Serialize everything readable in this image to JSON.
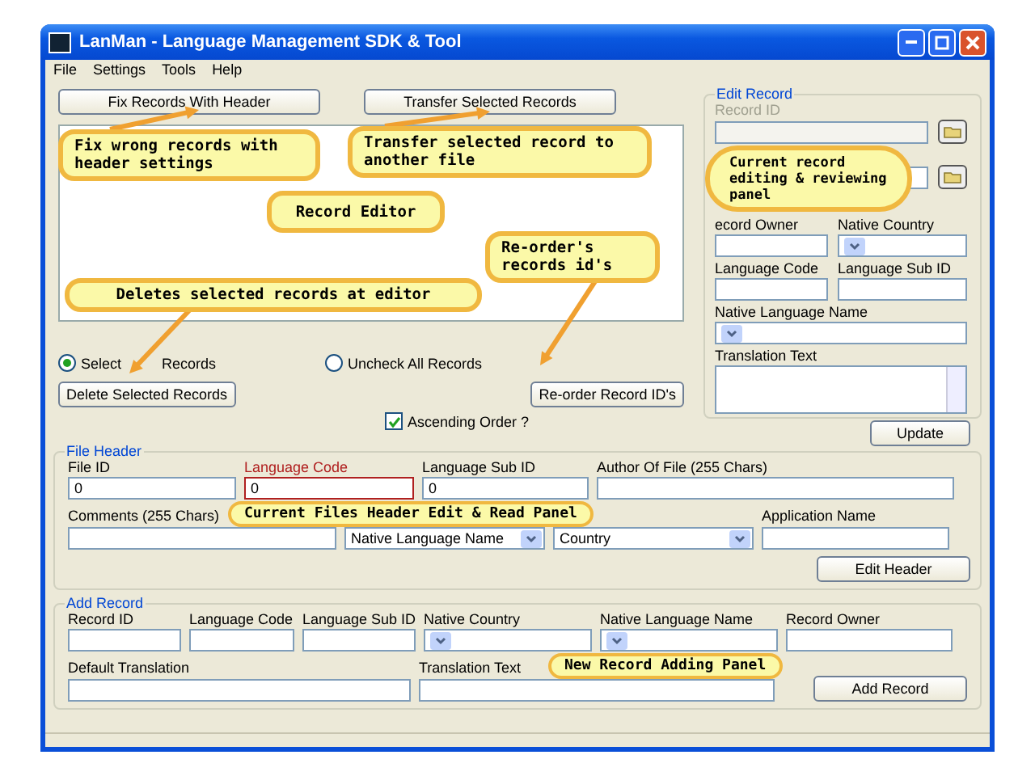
{
  "window": {
    "title": "LanMan - Language Management SDK & Tool"
  },
  "menu": [
    {
      "label": "File"
    },
    {
      "label": "Settings"
    },
    {
      "label": "Tools"
    },
    {
      "label": "Help"
    }
  ],
  "top_buttons": [
    "Fix Records With Header",
    "Transfer Selected Records"
  ],
  "radios": [
    {
      "label": "Select",
      "label_after": "Records",
      "selected": true
    },
    {
      "label": "Uncheck All Records",
      "selected": false
    }
  ],
  "delete_button": "Delete Selected Records",
  "reorder_button": "Re-order Record ID's",
  "ascending": {
    "label": "Ascending Order ?",
    "checked": true
  },
  "edit_record": {
    "title": "Edit Record",
    "fields": [
      {
        "label": "Record ID",
        "kind": "browse",
        "disabled": true
      },
      {
        "kind": "browse",
        "disabled": false
      },
      {
        "label": "ecord Owner",
        "kind": "text",
        "disabled": false
      },
      {
        "label": "Native Country",
        "kind": "combo",
        "disabled": false
      },
      {
        "label": "Language Code",
        "kind": "text",
        "disabled": false
      },
      {
        "label": "Language Sub ID",
        "kind": "text",
        "disabled": false
      },
      {
        "label": "Native Language Name",
        "kind": "combo",
        "disabled": false
      },
      {
        "label": "Translation Text",
        "kind": "textarea",
        "disabled": false
      }
    ],
    "button": "Update"
  },
  "file_header": {
    "title": "File Header",
    "fields": [
      {
        "label": "File ID",
        "value": "0",
        "kind": "text",
        "error": false
      },
      {
        "label": "Language Code",
        "value": "0",
        "kind": "text",
        "error": true
      },
      {
        "label": "Language Sub ID",
        "value": "0",
        "kind": "text",
        "error": false
      },
      {
        "label": "Author Of File (255 Chars)",
        "kind": "text",
        "error": false
      },
      {
        "label": "Comments (255 Chars)",
        "kind": "text",
        "error": false
      },
      {
        "value": "Native Language Name",
        "kind": "combo",
        "error": false
      },
      {
        "value": "Country",
        "kind": "combo",
        "error": false
      },
      {
        "label": "Application Name",
        "kind": "text",
        "error": false
      }
    ],
    "button": "Edit Header"
  },
  "add_record": {
    "title": "Add Record",
    "fields": [
      {
        "label": "Record ID",
        "kind": "text"
      },
      {
        "label": "Language Code",
        "kind": "text"
      },
      {
        "label": "Language Sub ID",
        "kind": "text"
      },
      {
        "label": "Native Country",
        "kind": "combo"
      },
      {
        "label": "Native Language Name",
        "kind": "combo"
      },
      {
        "label": "Record Owner",
        "kind": "text"
      },
      {
        "label": "Default Translation",
        "kind": "text"
      },
      {
        "label": "Translation Text",
        "kind": "text"
      }
    ],
    "button": "Add Record"
  },
  "callouts": [
    {
      "text": "Fix wrong records with header settings"
    },
    {
      "text": "Transfer selected record to another file"
    },
    {
      "text": "Record Editor"
    },
    {
      "text": "Re-order's records id's"
    },
    {
      "text": "Deletes selected records at editor"
    },
    {
      "text": "Current record editing & reviewing panel"
    },
    {
      "text": "Current Files Header Edit & Read Panel"
    },
    {
      "text": "New Record Adding Panel"
    }
  ]
}
